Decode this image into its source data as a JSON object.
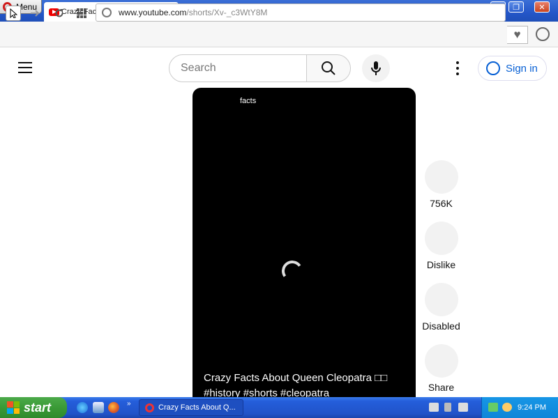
{
  "browser": {
    "menu_label": "Menu",
    "tab_title": "Crazy Facts About Queen Cleopatra",
    "tab_close": "✕",
    "new_tab": "+",
    "window_controls": {
      "minimize": "▁",
      "maximize": "❐",
      "close": "✕"
    },
    "address_domain": "www.youtube.com",
    "address_path": "/shorts/Xv-_c3WtY8M"
  },
  "youtube": {
    "search_placeholder": "Search",
    "sign_in_label": "Sign in",
    "video": {
      "chip_label": "facts",
      "title": "Crazy Facts About Queen Cleopatra □□ #history #shorts #cleopatra"
    },
    "actions": [
      {
        "label": "756K",
        "icon": "like-icon"
      },
      {
        "label": "Dislike",
        "icon": "dislike-icon"
      },
      {
        "label": "Disabled",
        "icon": "comments-icon"
      },
      {
        "label": "Share",
        "icon": "share-icon"
      }
    ]
  },
  "taskbar": {
    "start_label": "start",
    "task_item": "Crazy Facts About Q...",
    "clock": "9:24 PM"
  },
  "colors": {
    "youtube_red": "#ff0000",
    "link_blue": "#065fd4",
    "xp_blue": "#245edb",
    "start_green": "#3a9a36"
  }
}
